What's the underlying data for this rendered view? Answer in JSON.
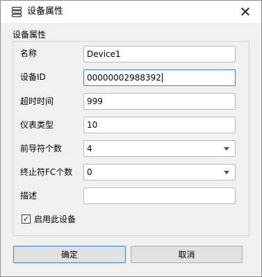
{
  "window": {
    "title": "设备属性",
    "close_symbol": "✕",
    "icon": "server-stack-icon"
  },
  "group": {
    "title": "设备属性"
  },
  "fields": [
    {
      "label": "名称",
      "value": "Device1",
      "type": "text"
    },
    {
      "label": "设备ID",
      "value": "00000002988392",
      "type": "text",
      "focused": true
    },
    {
      "label": "超时时间",
      "value": "999",
      "type": "text"
    },
    {
      "label": "仪表类型",
      "value": "10",
      "type": "text"
    },
    {
      "label": "前导符个数",
      "value": "4",
      "type": "combo"
    },
    {
      "label": "终止符FC个数",
      "value": "0",
      "type": "combo"
    },
    {
      "label": "描述",
      "value": "",
      "type": "text"
    }
  ],
  "checkbox": {
    "label": "启用此设备",
    "checked": true,
    "mark": "✓"
  },
  "buttons": {
    "ok": "确定",
    "cancel": "取消"
  },
  "colors": {
    "focus": "#3b82d6",
    "background": "#f0f0f0"
  }
}
